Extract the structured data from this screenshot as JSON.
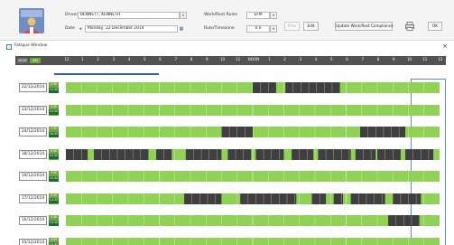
{
  "header": {
    "driver_label": "Driver",
    "driver_value": "BENNETT, KENNETH",
    "date_label": "Date",
    "date_value": "Monday, 22 December 2014",
    "work_rest_label": "Work/Rest Rules",
    "work_rest_value": "EFM",
    "rule_label": "Rule/Timezone",
    "rule_value": "0.0",
    "btn_disabled": "Prev",
    "btn_edit": "Edit",
    "btn_update": "Update Work/Rest Compliance",
    "btn_ok": "OK"
  },
  "panel": {
    "title": "Fatigue Window"
  },
  "ruler": {
    "left_buttons": [
      "NOW",
      "AM"
    ],
    "ticks": [
      "12",
      "1",
      "2",
      "3",
      "4",
      "5",
      "6",
      "7",
      "8",
      "9",
      "10",
      "11",
      "NOON",
      "1",
      "2",
      "3",
      "4",
      "5",
      "6",
      "7",
      "8",
      "9",
      "10",
      "11",
      "12"
    ]
  },
  "days": [
    {
      "date": "22/12/2014",
      "hours": [
        "5:30",
        "10:30"
      ],
      "work": [
        [
          12.0,
          13.5
        ],
        [
          14.1,
          17.6
        ]
      ]
    },
    {
      "date": "23/12/2014",
      "hours": [
        "5:30",
        "10:30"
      ],
      "work": []
    },
    {
      "date": "24/12/2014",
      "hours": [
        "7:30",
        "16:30"
      ],
      "work": [
        [
          10.0,
          12.0
        ],
        [
          18.9,
          21.8
        ]
      ]
    },
    {
      "date": "18/12/2014",
      "hours": [
        "8:30",
        "15:30"
      ],
      "work": [
        [
          0.0,
          1.4
        ],
        [
          1.8,
          5.3
        ],
        [
          5.8,
          6.8
        ],
        [
          7.7,
          10.0
        ],
        [
          10.4,
          11.9
        ],
        [
          12.2,
          14.0
        ],
        [
          14.5,
          15.9
        ],
        [
          16.2,
          18.3
        ],
        [
          18.6,
          19.9
        ],
        [
          20.0,
          21.5
        ],
        [
          21.8,
          23.6
        ]
      ]
    },
    {
      "date": "19/12/2014",
      "hours": [
        "3:30",
        "10:30"
      ],
      "work": []
    },
    {
      "date": "17/12/2014",
      "hours": [
        "9:30",
        "14:30"
      ],
      "work": [
        [
          7.6,
          10.0
        ],
        [
          11.2,
          14.8
        ],
        [
          15.8,
          16.7
        ],
        [
          17.2,
          17.8
        ],
        [
          18.3,
          20.5
        ],
        [
          21.0,
          22.8
        ]
      ]
    },
    {
      "date": "16/12/2014",
      "hours": [
        "3:30",
        "10:30"
      ],
      "work": [
        [
          20.7,
          22.7
        ]
      ]
    },
    {
      "date": "15/12/2014",
      "hours": [
        "4:30",
        "10:30"
      ],
      "work": []
    }
  ],
  "colors": {
    "rest": "#90d255",
    "work": "#3f3f3f",
    "hours_top": "#6fa83a",
    "hours_bottom": "#1f6b2e",
    "ruler_bg": "#525252",
    "accent": "#2c5fb3"
  }
}
